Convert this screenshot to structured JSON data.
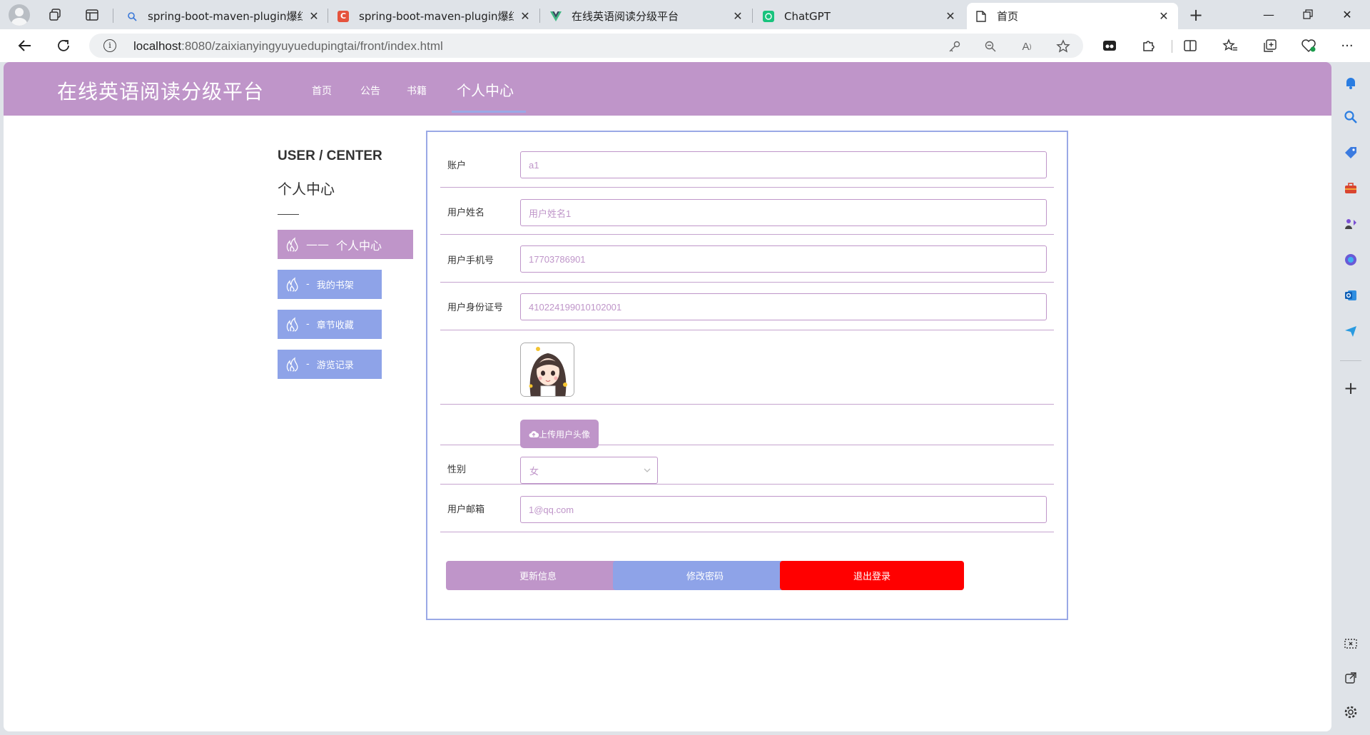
{
  "browser": {
    "tabs": [
      {
        "title": "spring-boot-maven-plugin爆红 -"
      },
      {
        "title": "spring-boot-maven-plugin爆红, "
      },
      {
        "title": "在线英语阅读分级平台"
      },
      {
        "title": "ChatGPT"
      },
      {
        "title": "首页"
      }
    ],
    "url_host": "localhost",
    "url_rest": ":8080/zaixianyingyuyuedupingtai/front/index.html"
  },
  "site": {
    "title": "在线英语阅读分级平台",
    "nav": [
      "首页",
      "公告",
      "书籍",
      "个人中心"
    ]
  },
  "user_center": {
    "title": "USER / CENTER",
    "subtitle": "个人中心",
    "menu": [
      {
        "dash": "——",
        "label": "个人中心"
      },
      {
        "dash": "-",
        "label": "我的书架"
      },
      {
        "dash": "-",
        "label": "章节收藏"
      },
      {
        "dash": "-",
        "label": "游览记录"
      }
    ]
  },
  "form": {
    "account": {
      "label": "账户",
      "value": "a1"
    },
    "name": {
      "label": "用户姓名",
      "value": "用户姓名1"
    },
    "phone": {
      "label": "用户手机号",
      "value": "17703786901"
    },
    "id_card": {
      "label": "用户身份证号",
      "value": "410224199010102001"
    },
    "upload_label": "上传用户头像",
    "gender": {
      "label": "性别",
      "value": "女"
    },
    "email": {
      "label": "用户邮箱",
      "value": "1@qq.com"
    },
    "buttons": {
      "update": "更新信息",
      "password": "修改密码",
      "logout": "退出登录"
    }
  },
  "colors": {
    "accent": "#bf95c9",
    "secondary": "#8ea3e8",
    "danger": "#ff0000"
  }
}
